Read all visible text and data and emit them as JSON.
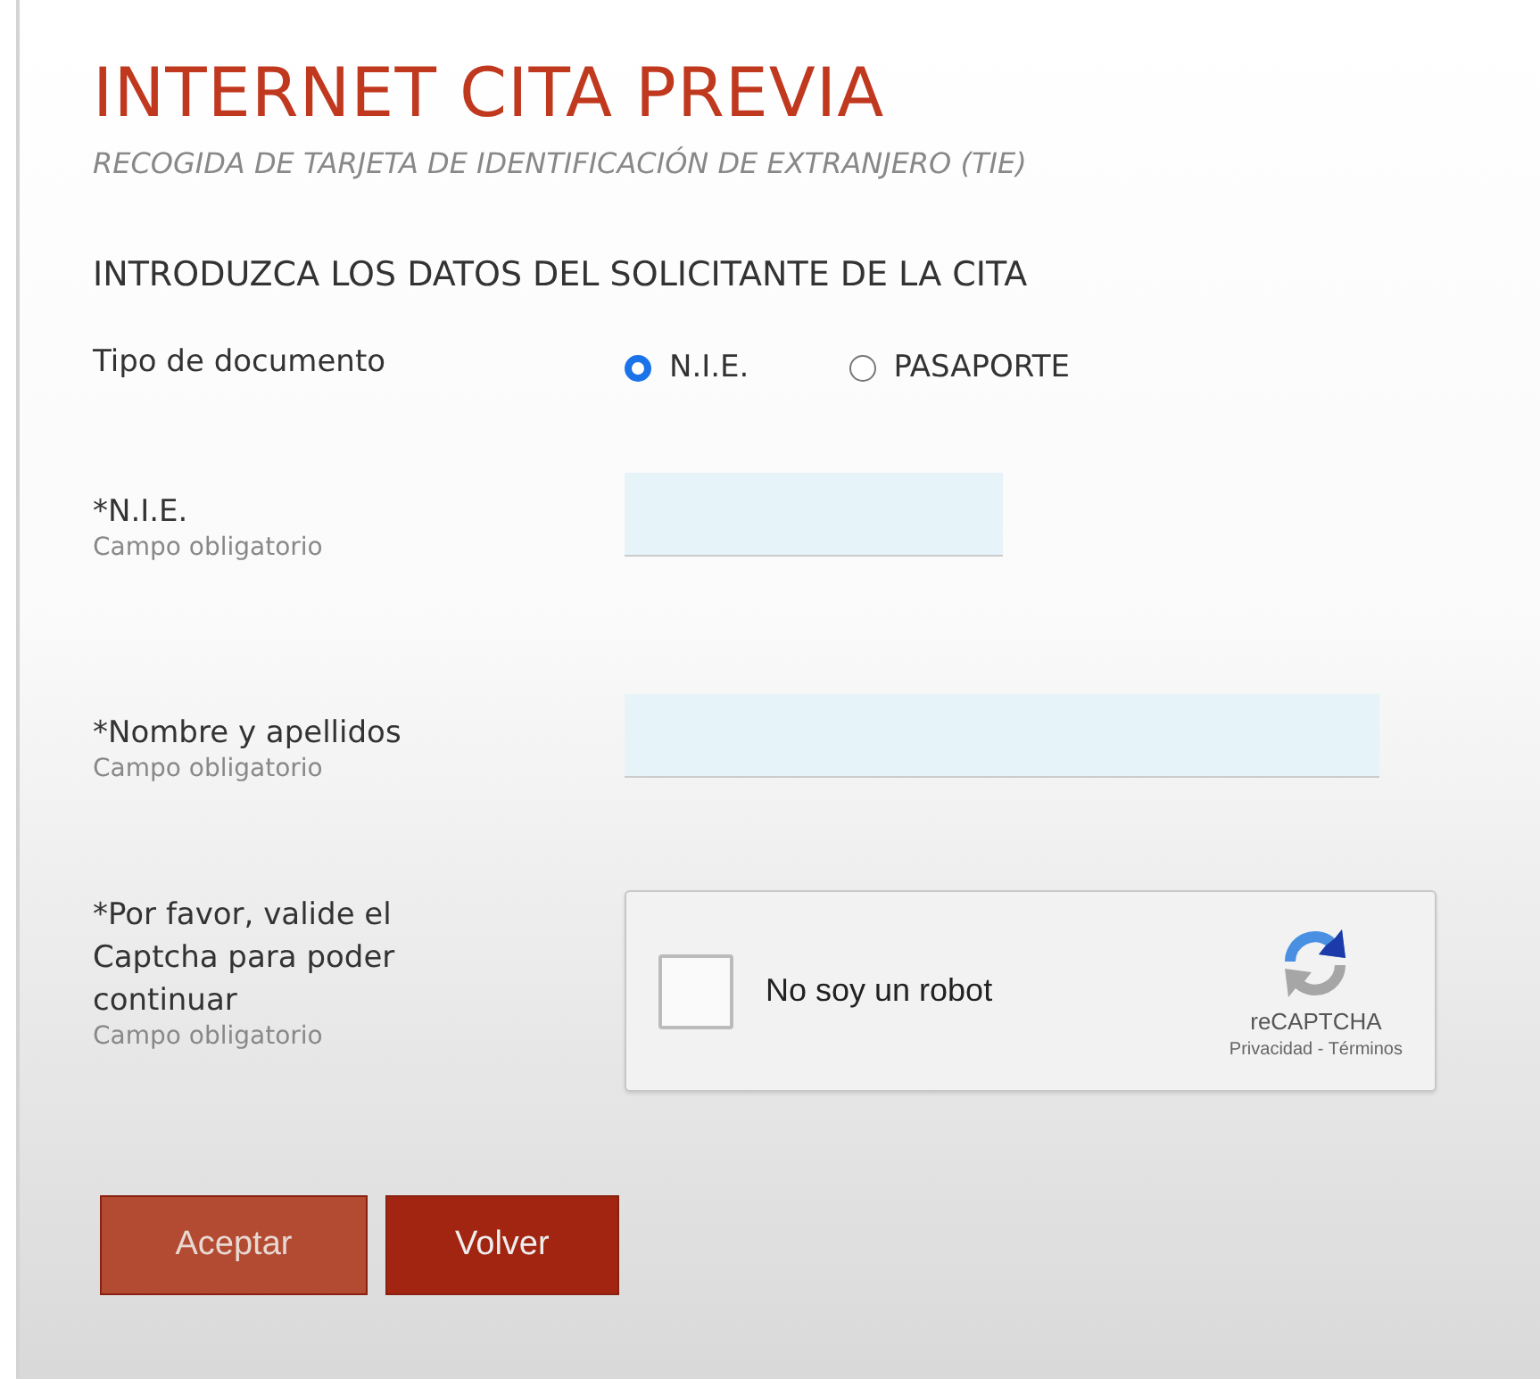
{
  "header": {
    "title": "INTERNET CITA PREVIA",
    "subtitle": "RECOGIDA DE TARJETA DE IDENTIFICACIÓN DE EXTRANJERO (TIE)"
  },
  "section_title": "INTRODUZCA LOS DATOS DEL SOLICITANTE DE LA CITA",
  "fields": [
    {
      "kind": "radio",
      "label": "Tipo de documento",
      "options": [
        {
          "label": "N.I.E.",
          "selected": true
        },
        {
          "label": "PASAPORTE",
          "selected": false
        }
      ]
    },
    {
      "kind": "text",
      "label": "*N.I.E.",
      "hint": "Campo obligatorio"
    },
    {
      "kind": "widetext",
      "label": "*Nombre y apellidos",
      "hint": "Campo obligatorio"
    },
    {
      "kind": "captcha",
      "label": "*Por favor, valide el Captcha para poder continuar",
      "hint": "Campo obligatorio",
      "checkbox_label": "No soy un robot",
      "checked": false,
      "brand": "reCAPTCHA",
      "links": "Privacidad - Términos"
    }
  ],
  "buttons": [
    {
      "label": "Aceptar",
      "disabled": true
    },
    {
      "label": "Volver",
      "disabled": false
    }
  ]
}
